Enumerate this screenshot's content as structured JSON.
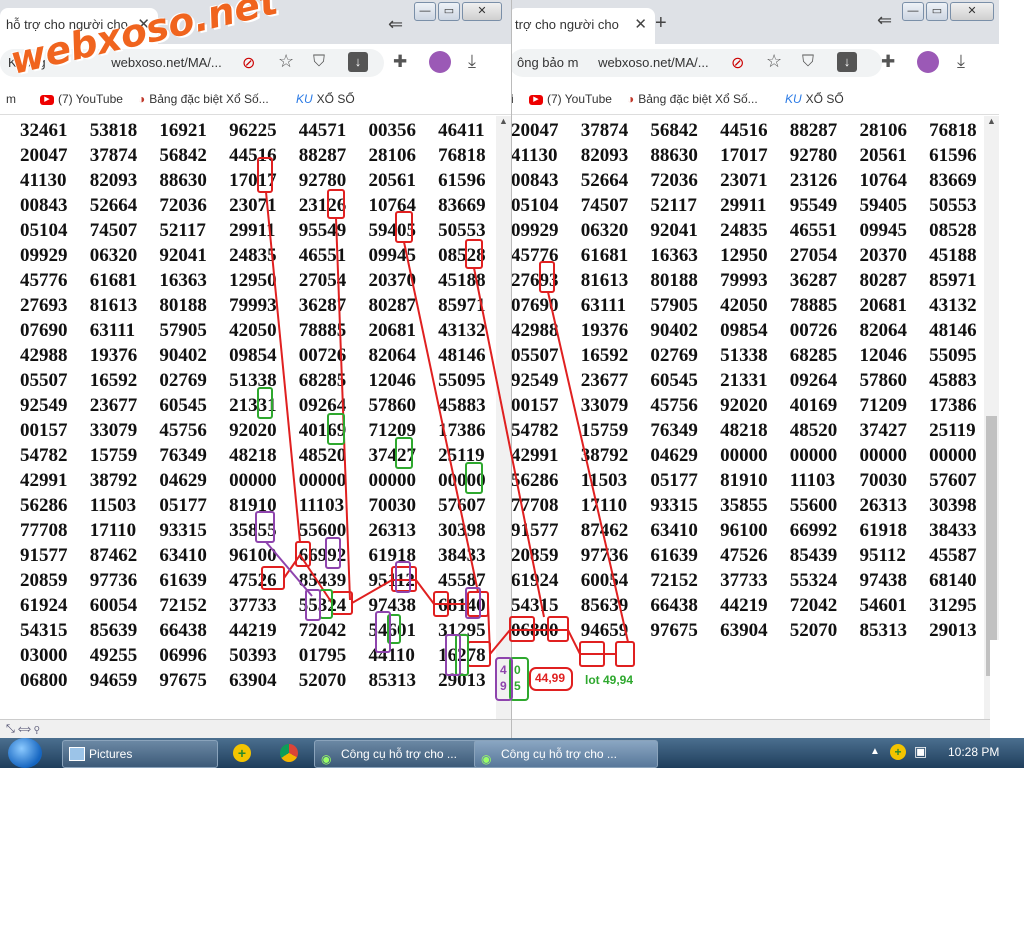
{
  "watermark": "webxoso.net",
  "left_window": {
    "tab_title": "hỗ trợ cho người cho",
    "address_prefix": "Không",
    "address": "webxoso.net/MA/...",
    "bookmarks": [
      {
        "label": "m",
        "icon": ""
      },
      {
        "label": "(7) YouTube",
        "icon": "youtube-icon"
      },
      {
        "label": "Bảng đặc biệt Xổ Số...",
        "icon": "xoso-icon"
      },
      {
        "label": "XỔ SỐ",
        "icon": "ku-icon"
      }
    ],
    "rows": [
      [
        "32461",
        "53818",
        "16921",
        "96225",
        "44571",
        "00356",
        "46411"
      ],
      [
        "20047",
        "37874",
        "56842",
        "44516",
        "88287",
        "28106",
        "76818"
      ],
      [
        "41130",
        "82093",
        "88630",
        "17017",
        "92780",
        "20561",
        "61596"
      ],
      [
        "00843",
        "52664",
        "72036",
        "23071",
        "23126",
        "10764",
        "83669"
      ],
      [
        "05104",
        "74507",
        "52117",
        "29911",
        "95549",
        "59405",
        "50553"
      ],
      [
        "09929",
        "06320",
        "92041",
        "24835",
        "46551",
        "09945",
        "08528"
      ],
      [
        "45776",
        "61681",
        "16363",
        "12950",
        "27054",
        "20370",
        "45188"
      ],
      [
        "27693",
        "81613",
        "80188",
        "79993",
        "36287",
        "80287",
        "85971"
      ],
      [
        "07690",
        "63111",
        "57905",
        "42050",
        "78885",
        "20681",
        "43132"
      ],
      [
        "42988",
        "19376",
        "90402",
        "09854",
        "00726",
        "82064",
        "48146"
      ],
      [
        "05507",
        "16592",
        "02769",
        "51338",
        "68285",
        "12046",
        "55095"
      ],
      [
        "92549",
        "23677",
        "60545",
        "21331",
        "09264",
        "57860",
        "45883"
      ],
      [
        "00157",
        "33079",
        "45756",
        "92020",
        "40169",
        "71209",
        "17386"
      ],
      [
        "54782",
        "15759",
        "76349",
        "48218",
        "48520",
        "37427",
        "25119"
      ],
      [
        "42991",
        "38792",
        "04629",
        "00000",
        "00000",
        "00000",
        "00000"
      ],
      [
        "56286",
        "11503",
        "05177",
        "81910",
        "11103",
        "70030",
        "57607"
      ],
      [
        "77708",
        "17110",
        "93315",
        "35855",
        "55600",
        "26313",
        "30398"
      ],
      [
        "91577",
        "87462",
        "63410",
        "96100",
        "66992",
        "61918",
        "38433"
      ],
      [
        "20859",
        "97736",
        "61639",
        "47526",
        "85439",
        "95112",
        "45587"
      ],
      [
        "61924",
        "60054",
        "72152",
        "37733",
        "55324",
        "97438",
        "68140"
      ],
      [
        "54315",
        "85639",
        "66438",
        "44219",
        "72042",
        "54601",
        "31295"
      ],
      [
        "03000",
        "49255",
        "06996",
        "50393",
        "01795",
        "44110",
        "16278"
      ],
      [
        "06800",
        "94659",
        "97675",
        "63904",
        "52070",
        "85313",
        "29013"
      ]
    ]
  },
  "right_window": {
    "tab_title": "trợ cho người cho",
    "address_prefix": "ông bảo m",
    "address": "webxoso.net/MA/...",
    "bookmarks": [
      {
        "label": "i",
        "icon": ""
      },
      {
        "label": "(7) YouTube",
        "icon": "youtube-icon"
      },
      {
        "label": "Bảng đặc biệt Xổ Số...",
        "icon": "xoso-icon"
      },
      {
        "label": "XỔ SỐ",
        "icon": "ku-icon"
      }
    ],
    "rows": [
      [
        "20047",
        "37874",
        "56842",
        "44516",
        "88287",
        "28106",
        "76818"
      ],
      [
        "41130",
        "82093",
        "88630",
        "17017",
        "92780",
        "20561",
        "61596"
      ],
      [
        "00843",
        "52664",
        "72036",
        "23071",
        "23126",
        "10764",
        "83669"
      ],
      [
        "05104",
        "74507",
        "52117",
        "29911",
        "95549",
        "59405",
        "50553"
      ],
      [
        "09929",
        "06320",
        "92041",
        "24835",
        "46551",
        "09945",
        "08528"
      ],
      [
        "45776",
        "61681",
        "16363",
        "12950",
        "27054",
        "20370",
        "45188"
      ],
      [
        "27693",
        "81613",
        "80188",
        "79993",
        "36287",
        "80287",
        "85971"
      ],
      [
        "07690",
        "63111",
        "57905",
        "42050",
        "78885",
        "20681",
        "43132"
      ],
      [
        "42988",
        "19376",
        "90402",
        "09854",
        "00726",
        "82064",
        "48146"
      ],
      [
        "05507",
        "16592",
        "02769",
        "51338",
        "68285",
        "12046",
        "55095"
      ],
      [
        "92549",
        "23677",
        "60545",
        "21331",
        "09264",
        "57860",
        "45883"
      ],
      [
        "00157",
        "33079",
        "45756",
        "92020",
        "40169",
        "71209",
        "17386"
      ],
      [
        "54782",
        "15759",
        "76349",
        "48218",
        "48520",
        "37427",
        "25119"
      ],
      [
        "42991",
        "38792",
        "04629",
        "00000",
        "00000",
        "00000",
        "00000"
      ],
      [
        "56286",
        "11503",
        "05177",
        "81910",
        "11103",
        "70030",
        "57607"
      ],
      [
        "77708",
        "17110",
        "93315",
        "35855",
        "55600",
        "26313",
        "30398"
      ],
      [
        "91577",
        "87462",
        "63410",
        "96100",
        "66992",
        "61918",
        "38433"
      ],
      [
        "20859",
        "97736",
        "61639",
        "47526",
        "85439",
        "95112",
        "45587"
      ],
      [
        "61924",
        "60054",
        "72152",
        "37733",
        "55324",
        "97438",
        "68140"
      ],
      [
        "54315",
        "85639",
        "66438",
        "44219",
        "72042",
        "54601",
        "31295"
      ],
      [
        "06800",
        "94659",
        "97675",
        "63904",
        "52070",
        "85313",
        "29013"
      ]
    ]
  },
  "annotations": {
    "red_note": "44,99",
    "green_note": "lot 49,94",
    "purple_digits": [
      "4",
      "9"
    ],
    "green_digits": [
      "0",
      "5"
    ]
  },
  "taskbar": {
    "buttons": [
      "Pictures",
      "Công cụ hỗ trợ cho ...",
      "Công cụ hỗ trợ cho ..."
    ],
    "clock": "10:28 PM"
  }
}
